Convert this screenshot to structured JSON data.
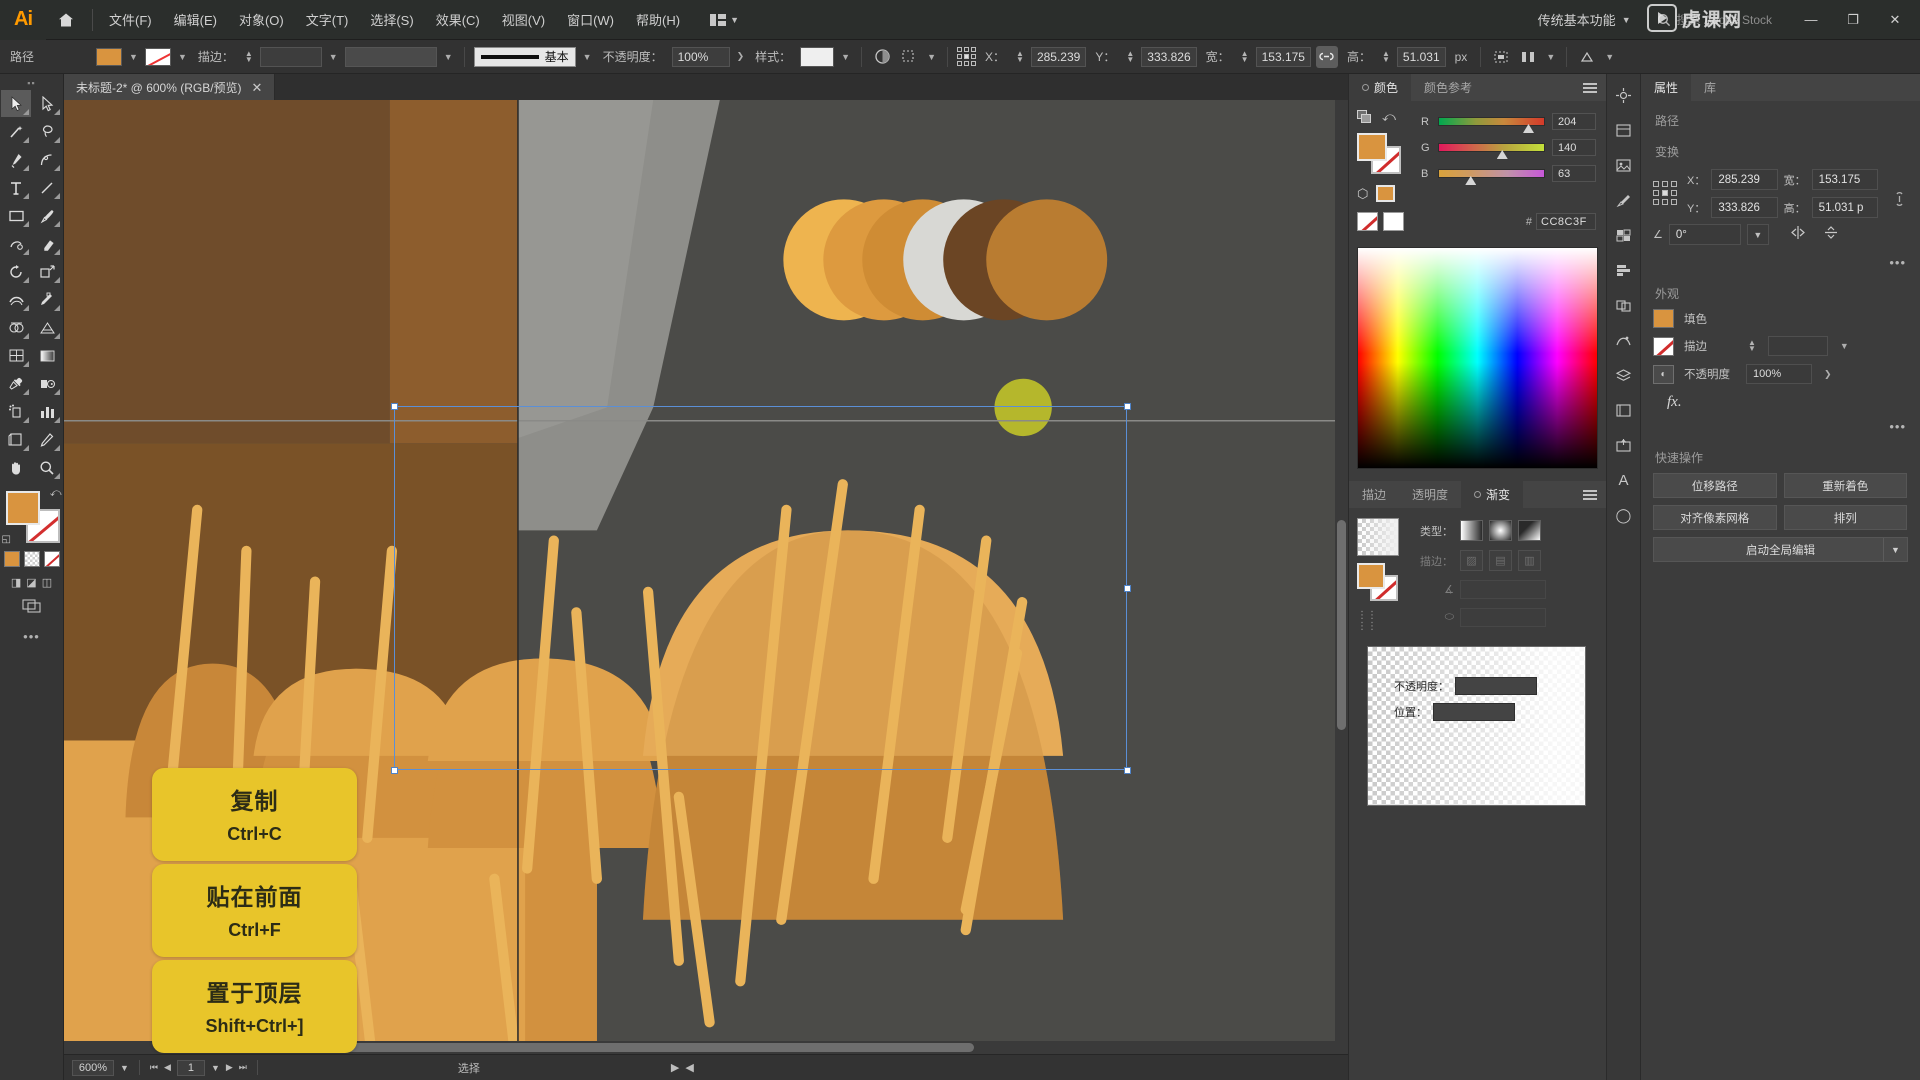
{
  "app": {
    "name": "Adobe Illustrator",
    "logo_text": "Ai",
    "workspace": "传统基本功能",
    "stock_search_placeholder": "搜索 Adobe Stock",
    "watermark": "虎课网"
  },
  "menubar": {
    "items": [
      {
        "label": "文件(F)",
        "name": "menu-file"
      },
      {
        "label": "编辑(E)",
        "name": "menu-edit"
      },
      {
        "label": "对象(O)",
        "name": "menu-object"
      },
      {
        "label": "文字(T)",
        "name": "menu-type"
      },
      {
        "label": "选择(S)",
        "name": "menu-select"
      },
      {
        "label": "效果(C)",
        "name": "menu-effect"
      },
      {
        "label": "视图(V)",
        "name": "menu-view"
      },
      {
        "label": "窗口(W)",
        "name": "menu-window"
      },
      {
        "label": "帮助(H)",
        "name": "menu-help"
      }
    ],
    "window_buttons": {
      "minimize": "—",
      "maximize": "❐",
      "close": "✕"
    }
  },
  "controlbar": {
    "object_label": "路径",
    "fill_color": "#d9943f",
    "stroke_label": "描边：",
    "stroke_weight": "",
    "stroke_profile": "基本",
    "opacity_label": "不透明度：",
    "opacity_value": "100%",
    "style_label": "样式：",
    "x_label": "X：",
    "x_value": "285.239",
    "y_label": "Y：",
    "y_value": "333.826",
    "w_label": "宽：",
    "w_value": "153.175",
    "h_label": "高：",
    "h_value": "51.031",
    "unit": "px"
  },
  "toolbar": {
    "tools": [
      {
        "name": "selection-tool",
        "label": "选择工具",
        "active": true
      },
      {
        "name": "direct-selection-tool",
        "label": "直接选择工具",
        "active": false
      },
      {
        "name": "magic-wand-tool",
        "label": "魔棒工具",
        "active": false
      },
      {
        "name": "lasso-tool",
        "label": "套索工具",
        "active": false
      },
      {
        "name": "pen-tool",
        "label": "钢笔工具",
        "active": false
      },
      {
        "name": "curvature-tool",
        "label": "曲率工具",
        "active": false
      },
      {
        "name": "type-tool",
        "label": "文字工具",
        "active": false
      },
      {
        "name": "line-segment-tool",
        "label": "直线段工具",
        "active": false
      },
      {
        "name": "rectangle-tool",
        "label": "矩形工具",
        "active": false
      },
      {
        "name": "paintbrush-tool",
        "label": "画笔工具",
        "active": false
      },
      {
        "name": "shaper-tool",
        "label": "Shaper 工具",
        "active": false
      },
      {
        "name": "eraser-tool",
        "label": "橡皮擦工具",
        "active": false
      },
      {
        "name": "rotate-tool",
        "label": "旋转工具",
        "active": false
      },
      {
        "name": "scale-tool",
        "label": "比例缩放工具",
        "active": false
      },
      {
        "name": "width-tool",
        "label": "宽度工具",
        "active": false
      },
      {
        "name": "free-transform-tool",
        "label": "自由变换工具",
        "active": false
      },
      {
        "name": "shape-builder-tool",
        "label": "形状生成器工具",
        "active": false
      },
      {
        "name": "perspective-grid-tool",
        "label": "透视网格工具",
        "active": false
      },
      {
        "name": "mesh-tool",
        "label": "网格工具",
        "active": false
      },
      {
        "name": "gradient-tool",
        "label": "渐变工具",
        "active": false
      },
      {
        "name": "eyedropper-tool",
        "label": "吸管工具",
        "active": false
      },
      {
        "name": "blend-tool",
        "label": "混合工具",
        "active": false
      },
      {
        "name": "symbol-sprayer-tool",
        "label": "符号喷枪工具",
        "active": false
      },
      {
        "name": "column-graph-tool",
        "label": "柱形图工具",
        "active": false
      },
      {
        "name": "artboard-tool",
        "label": "画板工具",
        "active": false
      },
      {
        "name": "slice-tool",
        "label": "切片工具",
        "active": false
      },
      {
        "name": "hand-tool",
        "label": "抓手工具",
        "active": false
      },
      {
        "name": "zoom-tool",
        "label": "缩放工具",
        "active": false
      }
    ],
    "fill_color": "#d9943f",
    "stroke_color": "none"
  },
  "document": {
    "tab_title": "未标题-2* @ 600% (RGB/预览)",
    "close_label": "✕"
  },
  "statusbar": {
    "zoom": "600%",
    "page": "1",
    "tool_status": "选择"
  },
  "panels": {
    "color": {
      "tabs": [
        {
          "label": "颜色",
          "active": true,
          "name": "panel-tab-color"
        },
        {
          "label": "颜色参考",
          "active": false,
          "name": "panel-tab-color-guide"
        }
      ],
      "sliders": [
        {
          "channel": "R",
          "value": "204",
          "pos": 80
        },
        {
          "channel": "G",
          "value": "140",
          "pos": 55
        },
        {
          "channel": "B",
          "value": "63",
          "pos": 25
        }
      ],
      "hex_label": "#",
      "hex_value": "CC8C3F",
      "fill_color": "#CC8C3F"
    },
    "gradient": {
      "tabs": [
        {
          "label": "描边",
          "active": false,
          "name": "panel-tab-stroke"
        },
        {
          "label": "透明度",
          "active": false,
          "name": "panel-tab-transparency"
        },
        {
          "label": "渐变",
          "active": true,
          "name": "panel-tab-gradient"
        }
      ],
      "type_label": "类型：",
      "stroke_label": "描边：",
      "opacity_label": "不透明度：",
      "location_label": "位置：",
      "opacity_value": "",
      "location_value": ""
    },
    "properties": {
      "tabs": [
        {
          "label": "属性",
          "active": true,
          "name": "panel-tab-properties"
        },
        {
          "label": "库",
          "active": false,
          "name": "panel-tab-libraries"
        }
      ],
      "object_type": "路径",
      "transform": {
        "title": "变换",
        "x_label": "X：",
        "x_value": "285.239",
        "y_label": "Y：",
        "y_value": "333.826",
        "w_label": "宽：",
        "w_value": "153.175",
        "h_label": "高：",
        "h_value": "51.031 p",
        "angle_label": "∠",
        "angle_value": "0°"
      },
      "appearance": {
        "title": "外观",
        "fill_label": "填色",
        "stroke_label": "描边",
        "opacity_label": "不透明度",
        "opacity_value": "100%",
        "fx_label": "fx."
      },
      "quick_actions": {
        "title": "快速操作",
        "buttons": [
          {
            "label": "位移路径",
            "name": "offset-path-button"
          },
          {
            "label": "重新着色",
            "name": "recolor-button"
          },
          {
            "label": "对齐像素网格",
            "name": "align-pixel-grid-button"
          },
          {
            "label": "排列",
            "name": "arrange-button"
          }
        ],
        "global_edit": "启动全局编辑"
      }
    }
  },
  "callouts": [
    {
      "title": "复制",
      "shortcut": "Ctrl+C",
      "name": "callout-copy"
    },
    {
      "title": "贴在前面",
      "shortcut": "Ctrl+F",
      "name": "callout-paste-in-front"
    },
    {
      "title": "置于顶层",
      "shortcut": "Shift+Ctrl+]",
      "name": "callout-bring-to-front"
    }
  ],
  "artwork": {
    "description": "橙黄色麦穗插画，带选区框",
    "colors": {
      "canvas_bg": "#4b4b48",
      "wall_dark": "#6b4a2a",
      "wall_mid": "#8a5c2c",
      "wall_light": "#9a6a2e",
      "gray_shape": "#8d8d8a",
      "wheat_light": "#e8b05c",
      "wheat_mid": "#d9943f",
      "wheat_dark": "#c07f34",
      "stalk": "#eab45a",
      "olive_dot": "#b5b72c",
      "white_circle": "#d8d8d4",
      "brown_circle": "#6b4524"
    }
  }
}
